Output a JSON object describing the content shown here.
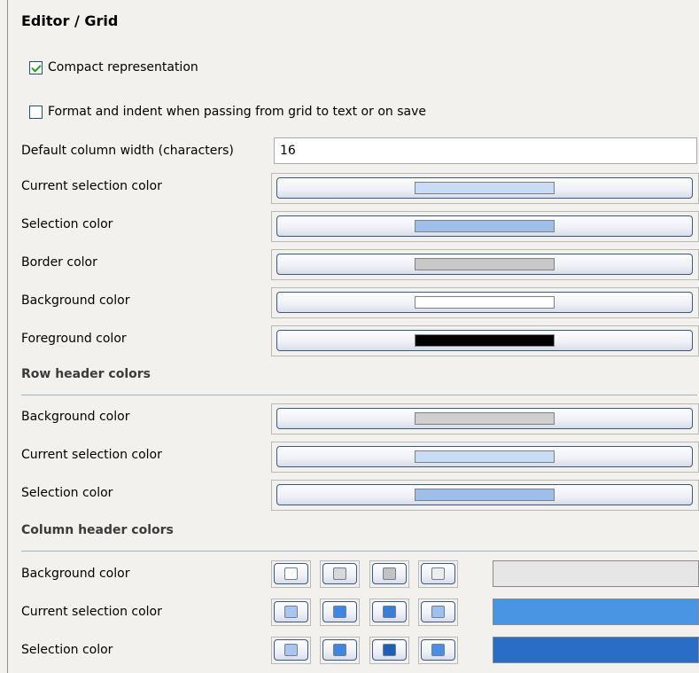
{
  "title": "Editor / Grid",
  "options": {
    "compact": {
      "label": "Compact representation",
      "checked": true
    },
    "format": {
      "label": "Format and indent when passing from grid to text or on save",
      "checked": false
    }
  },
  "default_width": {
    "label": "Default column width (characters)",
    "value": "16"
  },
  "grid_colors": [
    {
      "label": "Current selection color",
      "color": "#c9dcf5"
    },
    {
      "label": "Selection color",
      "color": "#9ebfea"
    },
    {
      "label": "Border color",
      "color": "#c8c8c8"
    },
    {
      "label": "Background color",
      "color": "#ffffff"
    },
    {
      "label": "Foreground color",
      "color": "#000000"
    }
  ],
  "row_header": {
    "title": "Row header colors",
    "items": [
      {
        "label": "Background color",
        "color": "#cfcfcf"
      },
      {
        "label": "Current selection color",
        "color": "#c9dcf5"
      },
      {
        "label": "Selection color",
        "color": "#9ebfea"
      }
    ]
  },
  "column_header": {
    "title": "Column header colors",
    "items": [
      {
        "label": "Background color",
        "swatches": [
          "#ffffff",
          "#d8d8d8",
          "#c2c2c2",
          "#eeeeee"
        ],
        "preview": "#e6e6e6"
      },
      {
        "label": "Current selection color",
        "swatches": [
          "#a9c7ee",
          "#3f86e0",
          "#3a7ed6",
          "#9ec0ee"
        ],
        "preview": "#4a95e3"
      },
      {
        "label": "Selection color",
        "swatches": [
          "#a9c7ee",
          "#3f86e0",
          "#1f5fb8",
          "#4a8fe4"
        ],
        "preview": "#2a6dc6"
      }
    ]
  }
}
